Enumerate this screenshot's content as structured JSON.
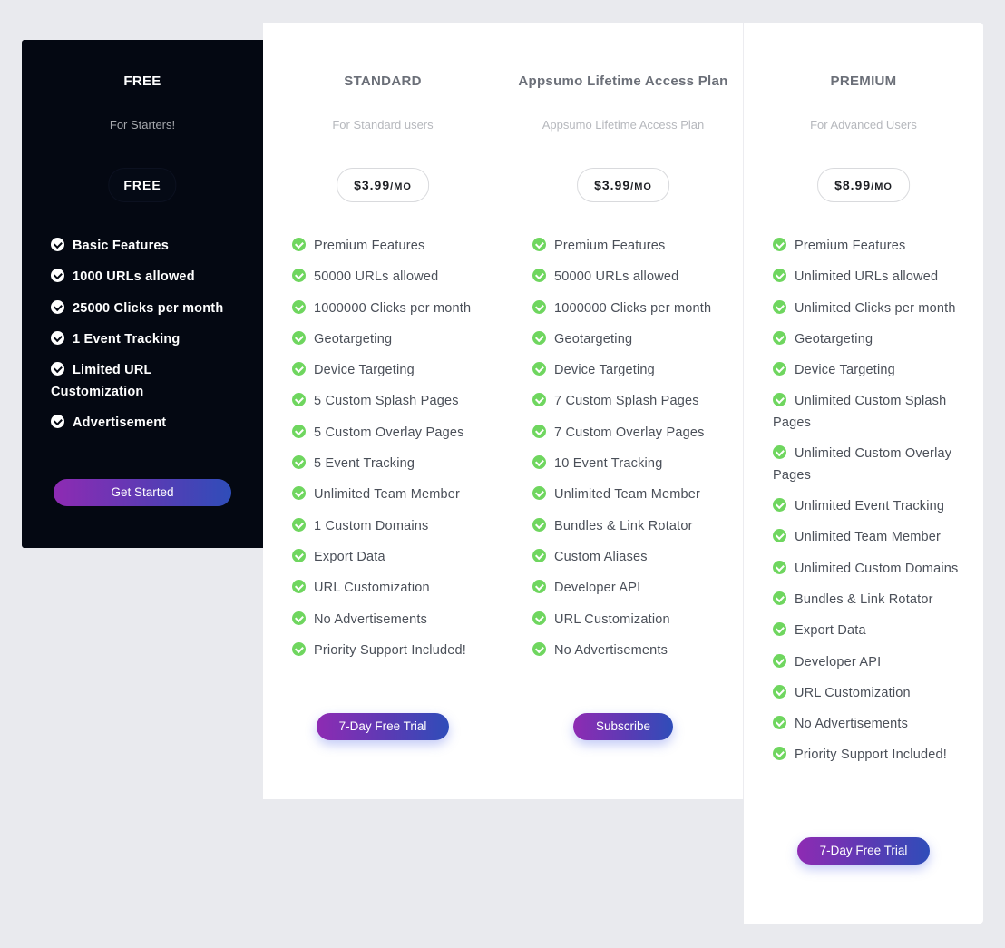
{
  "colors": {
    "background": "#e9eaee",
    "free_card_bg": "#040812",
    "check_green": "#6fd65f",
    "button_gradient_start": "#8e2bb3",
    "button_gradient_end": "#2f4db9"
  },
  "plans": [
    {
      "name": "FREE",
      "subtitle": "For Starters!",
      "price": "FREE",
      "price_unit": "",
      "features": [
        "Basic Features",
        "1000 URLs allowed",
        "25000 Clicks per month",
        "1 Event Tracking",
        "Limited URL Customization",
        "Advertisement"
      ],
      "cta": "Get Started"
    },
    {
      "name": "STANDARD",
      "subtitle": "For Standard users",
      "price": "$3.99",
      "price_unit": "/MO",
      "features": [
        "Premium Features",
        "50000 URLs allowed",
        "1000000 Clicks per month",
        "Geotargeting",
        "Device Targeting",
        "5 Custom Splash Pages",
        "5 Custom Overlay Pages",
        "5 Event Tracking",
        "Unlimited Team Member",
        "1 Custom Domains",
        "Export Data",
        "URL Customization",
        "No Advertisements",
        "Priority Support Included!"
      ],
      "cta": "7-Day Free Trial"
    },
    {
      "name": "Appsumo Lifetime Access Plan",
      "subtitle": "Appsumo Lifetime Access Plan",
      "price": "$3.99",
      "price_unit": "/MO",
      "features": [
        "Premium Features",
        "50000 URLs allowed",
        "1000000 Clicks per month",
        "Geotargeting",
        "Device Targeting",
        "7 Custom Splash Pages",
        "7 Custom Overlay Pages",
        "10 Event Tracking",
        "Unlimited Team Member",
        "Bundles & Link Rotator",
        "Custom Aliases",
        "Developer API",
        "URL Customization",
        "No Advertisements"
      ],
      "cta": "Subscribe"
    },
    {
      "name": "PREMIUM",
      "subtitle": "For Advanced Users",
      "price": "$8.99",
      "price_unit": "/MO",
      "features": [
        "Premium Features",
        "Unlimited URLs allowed",
        "Unlimited Clicks per month",
        "Geotargeting",
        "Device Targeting",
        "Unlimited Custom Splash Pages",
        "Unlimited Custom Overlay Pages",
        "Unlimited Event Tracking",
        "Unlimited Team Member",
        "Unlimited Custom Domains",
        "Bundles & Link Rotator",
        "Export Data",
        "Developer API",
        "URL Customization",
        "No Advertisements",
        "Priority Support Included!"
      ],
      "cta": "7-Day Free Trial"
    }
  ]
}
